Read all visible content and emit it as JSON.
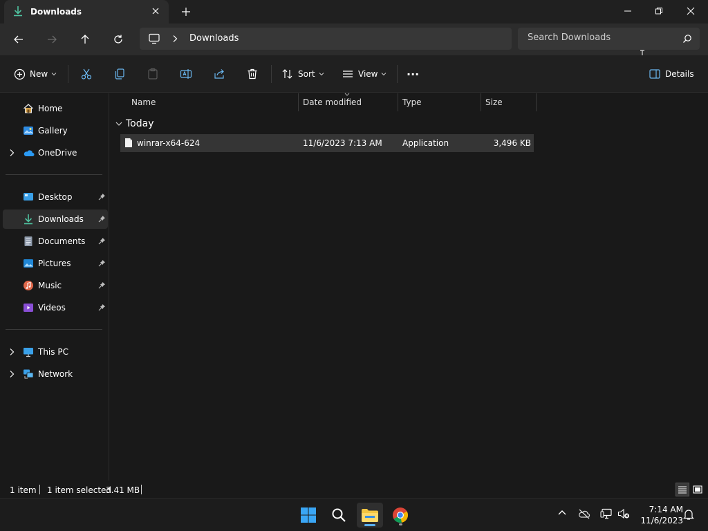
{
  "tab": {
    "title": "Downloads"
  },
  "address": {
    "segment": "Downloads"
  },
  "search": {
    "placeholder": "Search Downloads"
  },
  "command_bar": {
    "new_label": "New",
    "sort_label": "Sort",
    "view_label": "View",
    "more_label": "···",
    "details_label": "Details"
  },
  "sidebar": {
    "items": [
      {
        "label": "Home",
        "icon": "home-icon"
      },
      {
        "label": "Gallery",
        "icon": "gallery-icon"
      },
      {
        "label": "OneDrive",
        "icon": "onedrive-icon"
      },
      {
        "label": "Desktop",
        "icon": "desktop-icon"
      },
      {
        "label": "Downloads",
        "icon": "downloads-icon"
      },
      {
        "label": "Documents",
        "icon": "documents-icon"
      },
      {
        "label": "Pictures",
        "icon": "pictures-icon"
      },
      {
        "label": "Music",
        "icon": "music-icon"
      },
      {
        "label": "Videos",
        "icon": "videos-icon"
      },
      {
        "label": "This PC",
        "icon": "this-pc-icon"
      },
      {
        "label": "Network",
        "icon": "network-icon"
      }
    ]
  },
  "columns": {
    "name": "Name",
    "date": "Date modified",
    "type": "Type",
    "size": "Size"
  },
  "group": {
    "label": "Today"
  },
  "files": [
    {
      "name": "winrar-x64-624",
      "date": "11/6/2023 7:13 AM",
      "type": "Application",
      "size": "3,496 KB"
    }
  ],
  "status": {
    "count": "1 item",
    "selected": "1 item selected",
    "size": "3.41 MB"
  },
  "taskbar": {
    "time": "7:14 AM",
    "date": "11/6/2023"
  },
  "colors": {
    "accent": "#60cdff",
    "folder": "#f4c542",
    "selection": "#2d2d2d"
  }
}
